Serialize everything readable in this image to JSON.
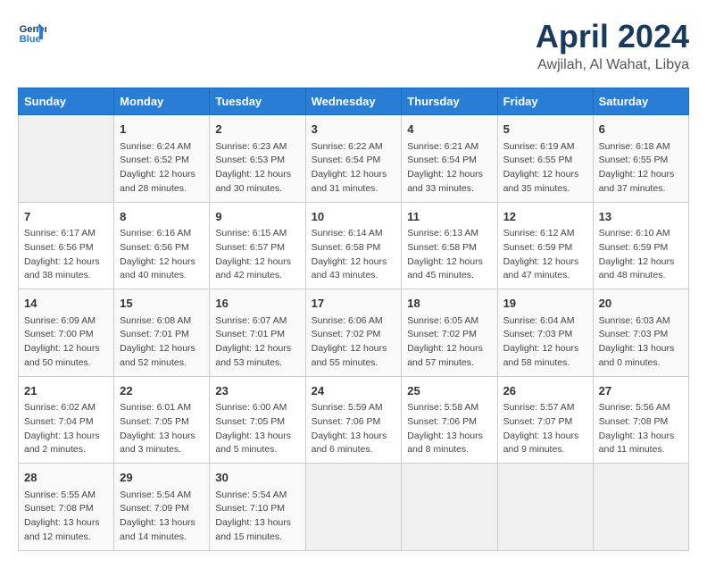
{
  "header": {
    "logo_line1": "General",
    "logo_line2": "Blue",
    "month": "April 2024",
    "location": "Awjilah, Al Wahat, Libya"
  },
  "columns": [
    "Sunday",
    "Monday",
    "Tuesday",
    "Wednesday",
    "Thursday",
    "Friday",
    "Saturday"
  ],
  "weeks": [
    [
      {
        "day": "",
        "content": ""
      },
      {
        "day": "1",
        "content": "Sunrise: 6:24 AM\nSunset: 6:52 PM\nDaylight: 12 hours\nand 28 minutes."
      },
      {
        "day": "2",
        "content": "Sunrise: 6:23 AM\nSunset: 6:53 PM\nDaylight: 12 hours\nand 30 minutes."
      },
      {
        "day": "3",
        "content": "Sunrise: 6:22 AM\nSunset: 6:54 PM\nDaylight: 12 hours\nand 31 minutes."
      },
      {
        "day": "4",
        "content": "Sunrise: 6:21 AM\nSunset: 6:54 PM\nDaylight: 12 hours\nand 33 minutes."
      },
      {
        "day": "5",
        "content": "Sunrise: 6:19 AM\nSunset: 6:55 PM\nDaylight: 12 hours\nand 35 minutes."
      },
      {
        "day": "6",
        "content": "Sunrise: 6:18 AM\nSunset: 6:55 PM\nDaylight: 12 hours\nand 37 minutes."
      }
    ],
    [
      {
        "day": "7",
        "content": "Sunrise: 6:17 AM\nSunset: 6:56 PM\nDaylight: 12 hours\nand 38 minutes."
      },
      {
        "day": "8",
        "content": "Sunrise: 6:16 AM\nSunset: 6:56 PM\nDaylight: 12 hours\nand 40 minutes."
      },
      {
        "day": "9",
        "content": "Sunrise: 6:15 AM\nSunset: 6:57 PM\nDaylight: 12 hours\nand 42 minutes."
      },
      {
        "day": "10",
        "content": "Sunrise: 6:14 AM\nSunset: 6:58 PM\nDaylight: 12 hours\nand 43 minutes."
      },
      {
        "day": "11",
        "content": "Sunrise: 6:13 AM\nSunset: 6:58 PM\nDaylight: 12 hours\nand 45 minutes."
      },
      {
        "day": "12",
        "content": "Sunrise: 6:12 AM\nSunset: 6:59 PM\nDaylight: 12 hours\nand 47 minutes."
      },
      {
        "day": "13",
        "content": "Sunrise: 6:10 AM\nSunset: 6:59 PM\nDaylight: 12 hours\nand 48 minutes."
      }
    ],
    [
      {
        "day": "14",
        "content": "Sunrise: 6:09 AM\nSunset: 7:00 PM\nDaylight: 12 hours\nand 50 minutes."
      },
      {
        "day": "15",
        "content": "Sunrise: 6:08 AM\nSunset: 7:01 PM\nDaylight: 12 hours\nand 52 minutes."
      },
      {
        "day": "16",
        "content": "Sunrise: 6:07 AM\nSunset: 7:01 PM\nDaylight: 12 hours\nand 53 minutes."
      },
      {
        "day": "17",
        "content": "Sunrise: 6:06 AM\nSunset: 7:02 PM\nDaylight: 12 hours\nand 55 minutes."
      },
      {
        "day": "18",
        "content": "Sunrise: 6:05 AM\nSunset: 7:02 PM\nDaylight: 12 hours\nand 57 minutes."
      },
      {
        "day": "19",
        "content": "Sunrise: 6:04 AM\nSunset: 7:03 PM\nDaylight: 12 hours\nand 58 minutes."
      },
      {
        "day": "20",
        "content": "Sunrise: 6:03 AM\nSunset: 7:03 PM\nDaylight: 13 hours\nand 0 minutes."
      }
    ],
    [
      {
        "day": "21",
        "content": "Sunrise: 6:02 AM\nSunset: 7:04 PM\nDaylight: 13 hours\nand 2 minutes."
      },
      {
        "day": "22",
        "content": "Sunrise: 6:01 AM\nSunset: 7:05 PM\nDaylight: 13 hours\nand 3 minutes."
      },
      {
        "day": "23",
        "content": "Sunrise: 6:00 AM\nSunset: 7:05 PM\nDaylight: 13 hours\nand 5 minutes."
      },
      {
        "day": "24",
        "content": "Sunrise: 5:59 AM\nSunset: 7:06 PM\nDaylight: 13 hours\nand 6 minutes."
      },
      {
        "day": "25",
        "content": "Sunrise: 5:58 AM\nSunset: 7:06 PM\nDaylight: 13 hours\nand 8 minutes."
      },
      {
        "day": "26",
        "content": "Sunrise: 5:57 AM\nSunset: 7:07 PM\nDaylight: 13 hours\nand 9 minutes."
      },
      {
        "day": "27",
        "content": "Sunrise: 5:56 AM\nSunset: 7:08 PM\nDaylight: 13 hours\nand 11 minutes."
      }
    ],
    [
      {
        "day": "28",
        "content": "Sunrise: 5:55 AM\nSunset: 7:08 PM\nDaylight: 13 hours\nand 12 minutes."
      },
      {
        "day": "29",
        "content": "Sunrise: 5:54 AM\nSunset: 7:09 PM\nDaylight: 13 hours\nand 14 minutes."
      },
      {
        "day": "30",
        "content": "Sunrise: 5:54 AM\nSunset: 7:10 PM\nDaylight: 13 hours\nand 15 minutes."
      },
      {
        "day": "",
        "content": ""
      },
      {
        "day": "",
        "content": ""
      },
      {
        "day": "",
        "content": ""
      },
      {
        "day": "",
        "content": ""
      }
    ]
  ]
}
